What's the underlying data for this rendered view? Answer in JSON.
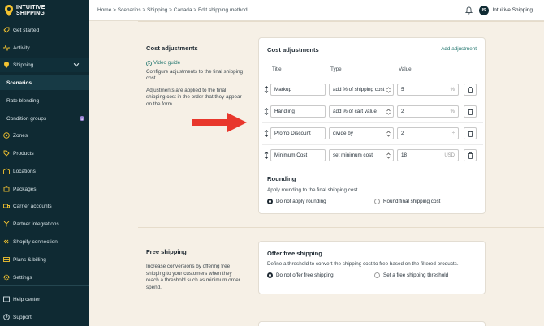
{
  "brand": {
    "line1": "INTUITIVE",
    "line2": "SHIPPING"
  },
  "sidebar": {
    "items": [
      {
        "label": "Get started",
        "icon": "rocket-icon"
      },
      {
        "label": "Activity",
        "icon": "activity-icon"
      },
      {
        "label": "Shipping",
        "icon": "shipping-icon"
      },
      {
        "label": "Scenarios"
      },
      {
        "label": "Rate blending"
      },
      {
        "label": "Condition groups",
        "badge": "1"
      },
      {
        "label": "Zones",
        "icon": "target-icon"
      },
      {
        "label": "Products",
        "icon": "products-icon"
      },
      {
        "label": "Locations",
        "icon": "locations-icon"
      },
      {
        "label": "Packages",
        "icon": "package-icon"
      },
      {
        "label": "Carrier accounts",
        "icon": "carrier-icon"
      },
      {
        "label": "Partner integrations",
        "icon": "partner-icon"
      },
      {
        "label": "Shopify connection",
        "icon": "link-icon"
      },
      {
        "label": "Plans & billing",
        "icon": "billing-icon"
      },
      {
        "label": "Settings",
        "icon": "gear-icon"
      },
      {
        "label": "Help center",
        "icon": "help-icon"
      },
      {
        "label": "Support",
        "icon": "support-icon"
      }
    ]
  },
  "topbar": {
    "breadcrumb": "Home > Scenarios > Shipping > Canada > Edit shipping method",
    "avatar_initials": "IS",
    "store_name": "Intuitive Shipping"
  },
  "cost_adjustments": {
    "left_title": "Cost adjustments",
    "video_link": "Video guide",
    "desc1": "Configure adjustments to the final shipping cost.",
    "desc2": "Adjustments are applied to the final shipping cost in the order that they appear on the form.",
    "card_title": "Cost adjustments",
    "add_label": "Add adjustment",
    "col_title": "Title",
    "col_type": "Type",
    "col_value": "Value",
    "rows": [
      {
        "title": "Markup",
        "type": "add % of shipping cost",
        "value": "5",
        "unit": "%"
      },
      {
        "title": "Handling",
        "type": "add % of cart value",
        "value": "2",
        "unit": "%"
      },
      {
        "title": "Promo Discount",
        "type": "divide by",
        "value": "2",
        "unit": "÷"
      },
      {
        "title": "Minimum Cost",
        "type": "set minimum cost",
        "value": "18",
        "unit": "USD"
      }
    ],
    "rounding_title": "Rounding",
    "rounding_desc": "Apply rounding to the final shipping cost.",
    "rounding_opt1": "Do not apply rounding",
    "rounding_opt2": "Round final shipping cost"
  },
  "free_shipping": {
    "left_title": "Free shipping",
    "desc": "Increase conversions by offering free shipping to your customers when they reach a threshold such as minimum order spend.",
    "card_title": "Offer free shipping",
    "card_desc": "Define a threshold to convert the shipping cost to free based on the filtered products.",
    "opt1": "Do not offer free shipping",
    "opt2": "Set a free shipping threshold"
  },
  "colors": {
    "sidebar_bg": "#0f2a33",
    "accent": "#23766f",
    "arrow": "#e8372c",
    "page_bg": "#f6f0e6"
  }
}
